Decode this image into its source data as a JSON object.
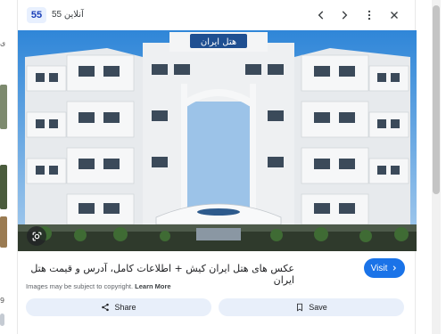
{
  "underlying_page": {
    "left_fragments": [
      "ی",
      "9"
    ]
  },
  "viewer": {
    "badge": "55",
    "site_name": "55 آنلاین",
    "caption": "عکس های هتل ایران کیش + اطلاعات کامل، آدرس و قیمت هتل ایران",
    "visit_label": "Visit",
    "copyright_text": "Images may be subject to copyright.",
    "learn_more": "Learn More",
    "share_label": "Share",
    "save_label": "Save",
    "image_sign": "هتل ایران"
  },
  "colors": {
    "accent": "#1a73e8",
    "badge_bg": "#e8f0fe",
    "action_bg": "#e8effa",
    "sky": "#3a8fdc"
  },
  "icons": [
    "chevron-left-icon",
    "chevron-right-icon",
    "more-vert-icon",
    "close-icon",
    "lens-icon",
    "share-icon",
    "bookmark-icon",
    "chevron-right-small-icon"
  ]
}
